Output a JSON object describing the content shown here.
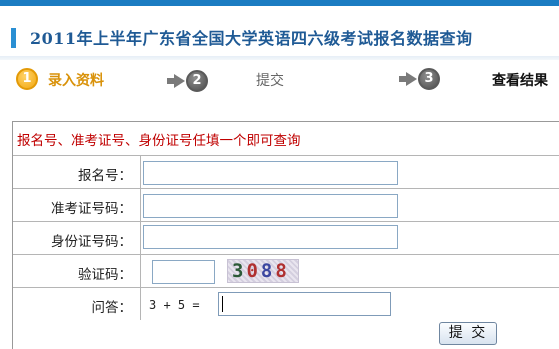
{
  "header": {
    "title": "2011年上半年广东省全国大学英语四六级考试报名数据查询"
  },
  "steps": [
    {
      "number": "1",
      "label": "录入资料"
    },
    {
      "number": "2",
      "label": "提交"
    },
    {
      "number": "3",
      "label": "查看结果"
    }
  ],
  "form": {
    "hint": "报名号、准考证号、身份证号任填一个即可查询",
    "fields": [
      {
        "label": "报名号：",
        "value": ""
      },
      {
        "label": "准考证号码：",
        "value": ""
      },
      {
        "label": "身份证号码：",
        "value": ""
      }
    ],
    "captcha": {
      "label": "验证码：",
      "value": "",
      "digits": [
        "3",
        "0",
        "8",
        "8"
      ]
    },
    "question": {
      "label": "问答：",
      "text": "3 + 5 =",
      "value": ""
    },
    "submit_label": "提 交"
  },
  "colors": {
    "accent": "#1b7cc2",
    "title": "#1f5a95",
    "active_step": "#d9920a",
    "hint": "#c00000"
  }
}
